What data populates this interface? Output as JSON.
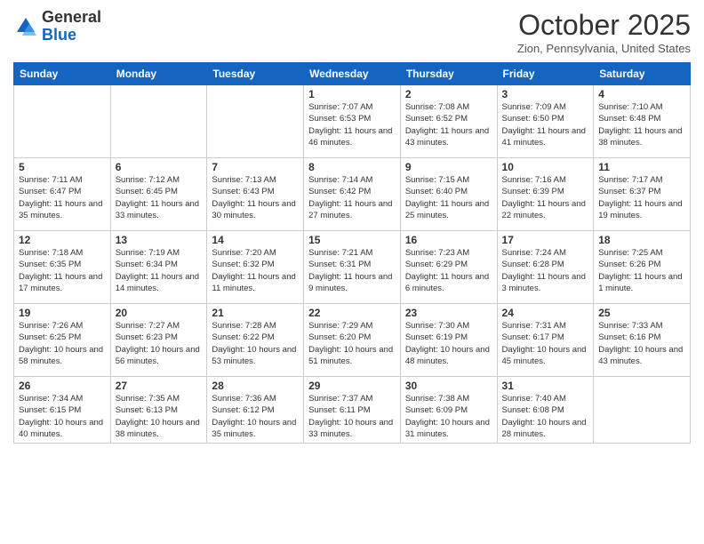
{
  "logo": {
    "general": "General",
    "blue": "Blue"
  },
  "header": {
    "month": "October 2025",
    "location": "Zion, Pennsylvania, United States"
  },
  "weekdays": [
    "Sunday",
    "Monday",
    "Tuesday",
    "Wednesday",
    "Thursday",
    "Friday",
    "Saturday"
  ],
  "weeks": [
    [
      {
        "day": "",
        "info": ""
      },
      {
        "day": "",
        "info": ""
      },
      {
        "day": "",
        "info": ""
      },
      {
        "day": "1",
        "info": "Sunrise: 7:07 AM\nSunset: 6:53 PM\nDaylight: 11 hours and 46 minutes."
      },
      {
        "day": "2",
        "info": "Sunrise: 7:08 AM\nSunset: 6:52 PM\nDaylight: 11 hours and 43 minutes."
      },
      {
        "day": "3",
        "info": "Sunrise: 7:09 AM\nSunset: 6:50 PM\nDaylight: 11 hours and 41 minutes."
      },
      {
        "day": "4",
        "info": "Sunrise: 7:10 AM\nSunset: 6:48 PM\nDaylight: 11 hours and 38 minutes."
      }
    ],
    [
      {
        "day": "5",
        "info": "Sunrise: 7:11 AM\nSunset: 6:47 PM\nDaylight: 11 hours and 35 minutes."
      },
      {
        "day": "6",
        "info": "Sunrise: 7:12 AM\nSunset: 6:45 PM\nDaylight: 11 hours and 33 minutes."
      },
      {
        "day": "7",
        "info": "Sunrise: 7:13 AM\nSunset: 6:43 PM\nDaylight: 11 hours and 30 minutes."
      },
      {
        "day": "8",
        "info": "Sunrise: 7:14 AM\nSunset: 6:42 PM\nDaylight: 11 hours and 27 minutes."
      },
      {
        "day": "9",
        "info": "Sunrise: 7:15 AM\nSunset: 6:40 PM\nDaylight: 11 hours and 25 minutes."
      },
      {
        "day": "10",
        "info": "Sunrise: 7:16 AM\nSunset: 6:39 PM\nDaylight: 11 hours and 22 minutes."
      },
      {
        "day": "11",
        "info": "Sunrise: 7:17 AM\nSunset: 6:37 PM\nDaylight: 11 hours and 19 minutes."
      }
    ],
    [
      {
        "day": "12",
        "info": "Sunrise: 7:18 AM\nSunset: 6:35 PM\nDaylight: 11 hours and 17 minutes."
      },
      {
        "day": "13",
        "info": "Sunrise: 7:19 AM\nSunset: 6:34 PM\nDaylight: 11 hours and 14 minutes."
      },
      {
        "day": "14",
        "info": "Sunrise: 7:20 AM\nSunset: 6:32 PM\nDaylight: 11 hours and 11 minutes."
      },
      {
        "day": "15",
        "info": "Sunrise: 7:21 AM\nSunset: 6:31 PM\nDaylight: 11 hours and 9 minutes."
      },
      {
        "day": "16",
        "info": "Sunrise: 7:23 AM\nSunset: 6:29 PM\nDaylight: 11 hours and 6 minutes."
      },
      {
        "day": "17",
        "info": "Sunrise: 7:24 AM\nSunset: 6:28 PM\nDaylight: 11 hours and 3 minutes."
      },
      {
        "day": "18",
        "info": "Sunrise: 7:25 AM\nSunset: 6:26 PM\nDaylight: 11 hours and 1 minute."
      }
    ],
    [
      {
        "day": "19",
        "info": "Sunrise: 7:26 AM\nSunset: 6:25 PM\nDaylight: 10 hours and 58 minutes."
      },
      {
        "day": "20",
        "info": "Sunrise: 7:27 AM\nSunset: 6:23 PM\nDaylight: 10 hours and 56 minutes."
      },
      {
        "day": "21",
        "info": "Sunrise: 7:28 AM\nSunset: 6:22 PM\nDaylight: 10 hours and 53 minutes."
      },
      {
        "day": "22",
        "info": "Sunrise: 7:29 AM\nSunset: 6:20 PM\nDaylight: 10 hours and 51 minutes."
      },
      {
        "day": "23",
        "info": "Sunrise: 7:30 AM\nSunset: 6:19 PM\nDaylight: 10 hours and 48 minutes."
      },
      {
        "day": "24",
        "info": "Sunrise: 7:31 AM\nSunset: 6:17 PM\nDaylight: 10 hours and 45 minutes."
      },
      {
        "day": "25",
        "info": "Sunrise: 7:33 AM\nSunset: 6:16 PM\nDaylight: 10 hours and 43 minutes."
      }
    ],
    [
      {
        "day": "26",
        "info": "Sunrise: 7:34 AM\nSunset: 6:15 PM\nDaylight: 10 hours and 40 minutes."
      },
      {
        "day": "27",
        "info": "Sunrise: 7:35 AM\nSunset: 6:13 PM\nDaylight: 10 hours and 38 minutes."
      },
      {
        "day": "28",
        "info": "Sunrise: 7:36 AM\nSunset: 6:12 PM\nDaylight: 10 hours and 35 minutes."
      },
      {
        "day": "29",
        "info": "Sunrise: 7:37 AM\nSunset: 6:11 PM\nDaylight: 10 hours and 33 minutes."
      },
      {
        "day": "30",
        "info": "Sunrise: 7:38 AM\nSunset: 6:09 PM\nDaylight: 10 hours and 31 minutes."
      },
      {
        "day": "31",
        "info": "Sunrise: 7:40 AM\nSunset: 6:08 PM\nDaylight: 10 hours and 28 minutes."
      },
      {
        "day": "",
        "info": ""
      }
    ]
  ]
}
